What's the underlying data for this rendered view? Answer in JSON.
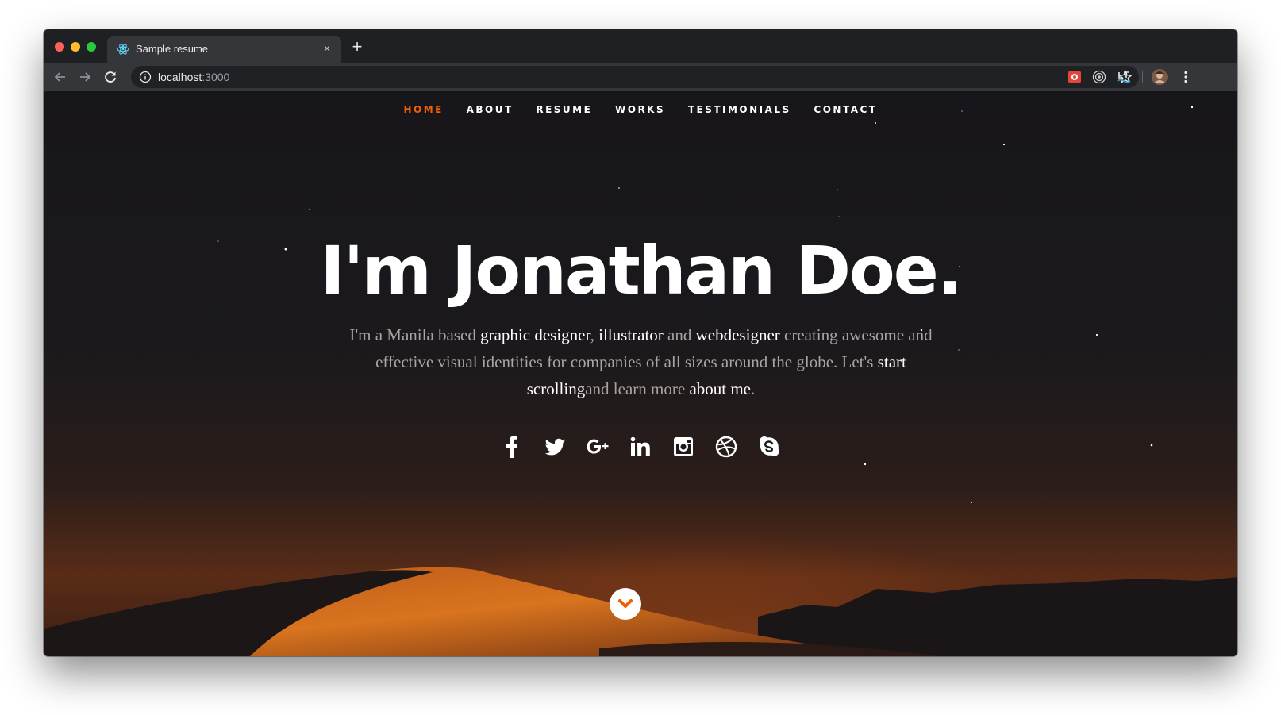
{
  "browser": {
    "tab_title": "Sample resume",
    "tab_close": "×",
    "new_tab": "+",
    "url_host": "localhost",
    "url_port": ":3000"
  },
  "nav": {
    "items": [
      "HOME",
      "ABOUT",
      "RESUME",
      "WORKS",
      "TESTIMONIALS",
      "CONTACT"
    ],
    "current": "HOME",
    "accent_color": "#f06000"
  },
  "hero": {
    "title": "I'm Jonathan Doe.",
    "text_parts": [
      {
        "text": "I'm a Manila based ",
        "highlight": false
      },
      {
        "text": "graphic designer",
        "highlight": true
      },
      {
        "text": ", ",
        "highlight": false
      },
      {
        "text": "illustrator",
        "highlight": true
      },
      {
        "text": " and ",
        "highlight": false
      },
      {
        "text": "webdesigner",
        "highlight": true
      },
      {
        "text": " creating awesome and effective visual identities for companies of all sizes around the globe. Let's ",
        "highlight": false
      },
      {
        "text": "start scrolling",
        "highlight": true
      },
      {
        "text": "and learn more ",
        "highlight": false
      },
      {
        "text": "about me",
        "highlight": true
      },
      {
        "text": ".",
        "highlight": false
      }
    ]
  },
  "social": [
    "facebook-icon",
    "twitter-icon",
    "google-plus-icon",
    "linkedin-icon",
    "instagram-icon",
    "dribbble-icon",
    "skype-icon"
  ],
  "scroll_down_icon": "chevron-down-icon"
}
